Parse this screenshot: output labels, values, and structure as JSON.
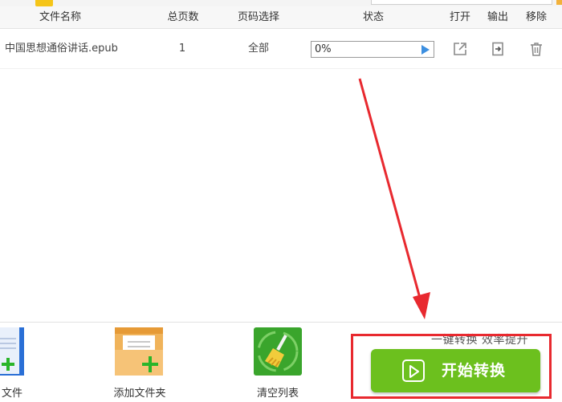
{
  "table": {
    "headers": {
      "name": "文件名称",
      "pages": "总页数",
      "range": "页码选择",
      "status": "状态",
      "open": "打开",
      "output": "输出",
      "remove": "移除"
    },
    "rows": [
      {
        "name": "中国思想通俗讲话.epub",
        "pages": "1",
        "range": "全部",
        "progress": "0%"
      }
    ]
  },
  "toolbar": {
    "add_file_label": "文件",
    "add_folder_label": "添加文件夹",
    "clear_list_label": "清空列表"
  },
  "convert": {
    "tagline": "一键转换  效率提升",
    "start_label": "开始转换"
  },
  "colors": {
    "start_button": "#6cc01e",
    "annotation_red": "#e8292f",
    "play_blue": "#3d8fe0"
  }
}
